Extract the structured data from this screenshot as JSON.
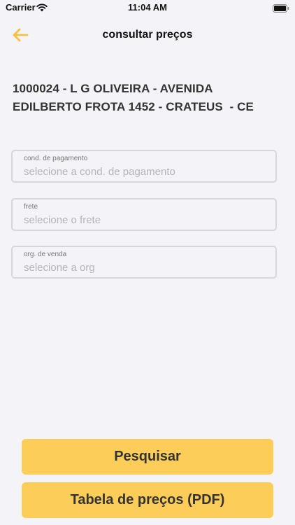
{
  "status_bar": {
    "carrier": "Carrier",
    "time": "11:04 AM"
  },
  "header": {
    "title": "consultar preços",
    "back_icon": "arrow-left-icon",
    "accent_color": "#f5c13f"
  },
  "customer": {
    "line1": "1000024 - L G OLIVEIRA - AVENIDA",
    "line2": "EDILBERTO FROTA 1452 - CRATEUS  - CE"
  },
  "form": {
    "payment_condition": {
      "label": "cond. de pagamento",
      "placeholder": "selecione a cond. de pagamento"
    },
    "freight": {
      "label": "frete",
      "placeholder": "selecione o frete"
    },
    "sales_org": {
      "label": "org. de venda",
      "placeholder": "selecione a org"
    }
  },
  "actions": {
    "search_label": "Pesquisar",
    "pdf_label": "Tabela de preços (PDF)",
    "button_color": "#fdcd5a"
  }
}
